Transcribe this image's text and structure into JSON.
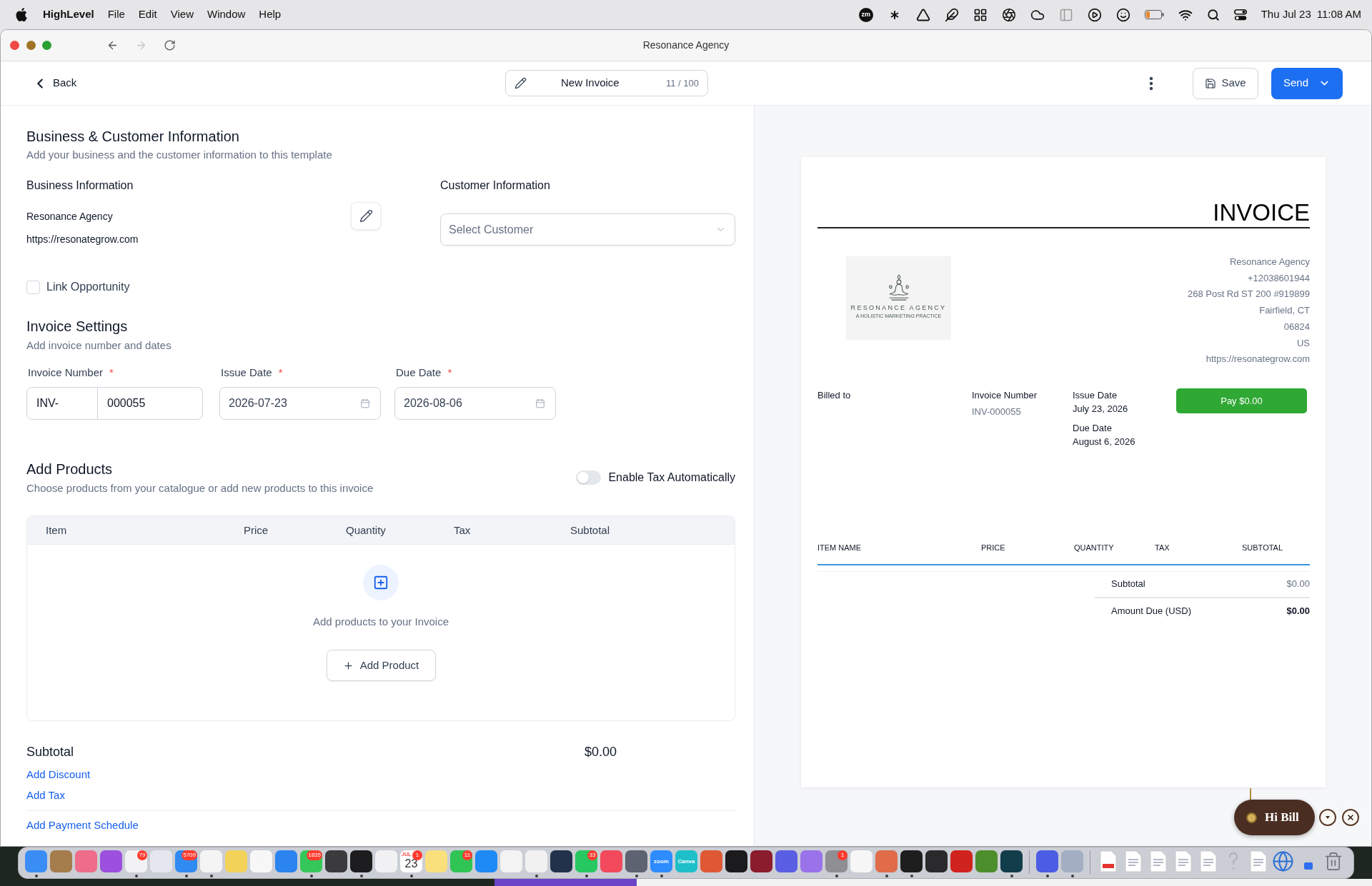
{
  "menu_bar": {
    "app_name": "HighLevel",
    "menus": [
      "File",
      "Edit",
      "View",
      "Window",
      "Help"
    ],
    "status_item": "zm",
    "date": "Thu Jul 23",
    "time": "11:08 AM"
  },
  "browser": {
    "title": "Resonance Agency",
    "back_disabled": false,
    "forward_disabled": true
  },
  "header": {
    "back": "Back",
    "title": "New Invoice",
    "counter": "11 / 100",
    "save": "Save",
    "send": "Send"
  },
  "business_customer": {
    "title": "Business & Customer Information",
    "subtitle": "Add your business and the customer information to this template",
    "business": {
      "heading": "Business Information",
      "name": "Resonance Agency",
      "website": "https://resonategrow.com"
    },
    "customer": {
      "heading": "Customer Information",
      "placeholder": "Select Customer"
    },
    "link_opportunity": {
      "label": "Link Opportunity",
      "checked": false
    }
  },
  "invoice_settings": {
    "title": "Invoice Settings",
    "subtitle": "Add invoice number and dates",
    "fields": [
      {
        "kind": "number",
        "label": "Invoice Number",
        "required_mark": "*",
        "prefix": "INV-",
        "value": "000055"
      },
      {
        "kind": "date",
        "label": "Issue Date",
        "required_mark": "*",
        "value": "2026-07-23"
      },
      {
        "kind": "date",
        "label": "Due Date",
        "required_mark": "*",
        "value": "2026-08-06"
      }
    ]
  },
  "products": {
    "title": "Add Products",
    "subtitle": "Choose products from your catalogue or add new products to this invoice",
    "tax_toggle": {
      "label": "Enable Tax Automatically",
      "on": false
    },
    "columns": [
      "Item",
      "Price",
      "Quantity",
      "Tax",
      "Subtotal"
    ],
    "empty_text": "Add products to your Invoice",
    "add_button": "Add Product"
  },
  "totals": {
    "subtotal_label": "Subtotal",
    "subtotal_value": "$0.00",
    "adjustments": [
      "Add Discount",
      "Add Tax"
    ],
    "schedule_link": "Add Payment Schedule"
  },
  "preview": {
    "title": "INVOICE",
    "logo": {
      "name": "RESONANCE AGENCY",
      "tagline": "A HOLISTIC MARKETING PRACTICE"
    },
    "address": [
      "Resonance Agency",
      "+12038601944",
      "268 Post Rd ST 200 #919899",
      "Fairfield, CT",
      "06824",
      "US",
      "https://resonategrow.com"
    ],
    "billed_to": "Billed to",
    "invoice_number": {
      "label": "Invoice Number",
      "value": "INV-000055"
    },
    "issue_date": {
      "label": "Issue Date",
      "value": "July 23, 2026"
    },
    "due_date": {
      "label": "Due Date",
      "value": "August 6, 2026"
    },
    "pay_button": "Pay $0.00",
    "columns": [
      "ITEM NAME",
      "PRICE",
      "QUANTITY",
      "TAX",
      "SUBTOTAL"
    ],
    "subtotal": {
      "label": "Subtotal",
      "value": "$0.00"
    },
    "amount_due": {
      "label": "Amount Due (USD)",
      "value": "$0.00"
    }
  },
  "chat_widget": {
    "greeting": "Hi Bill"
  },
  "dock": {
    "apps": [
      {
        "kind": "app",
        "color": "#3a8df4",
        "running": true
      },
      {
        "kind": "app",
        "color": "#a57c4c",
        "running": false
      },
      {
        "kind": "app",
        "color": "#ef6d8a",
        "running": false
      },
      {
        "kind": "app",
        "color": "#9c50dd",
        "running": false
      },
      {
        "kind": "app",
        "color": "#f2f2f4",
        "running": true,
        "badge": "79"
      },
      {
        "kind": "app",
        "color": "#e5e7ee",
        "running": false
      },
      {
        "kind": "app",
        "color": "#2f8bf2",
        "running": true,
        "badge": "5709"
      },
      {
        "kind": "app",
        "color": "#f4f4f4",
        "running": true
      },
      {
        "kind": "app",
        "color": "#f4d35a",
        "running": false
      },
      {
        "kind": "app",
        "color": "#f7f7f7",
        "running": false
      },
      {
        "kind": "app",
        "color": "#2b84f0",
        "running": false
      },
      {
        "kind": "app",
        "color": "#35c75a",
        "running": true,
        "badge": "1835"
      },
      {
        "kind": "app",
        "color": "#3b3b3d",
        "running": false
      },
      {
        "kind": "app",
        "color": "#1d1d1f",
        "running": true
      },
      {
        "kind": "app",
        "color": "#f1f1f3",
        "running": false
      },
      {
        "kind": "calendar",
        "color": "#ffffff",
        "running": true,
        "month": "JUL",
        "label": "23",
        "badge": "1"
      },
      {
        "kind": "app",
        "color": "#f9e07c",
        "running": false
      },
      {
        "kind": "app",
        "color": "#30c455",
        "running": false,
        "badge": "11"
      },
      {
        "kind": "app",
        "color": "#1e8af5",
        "running": false
      },
      {
        "kind": "app",
        "color": "#f3f3f3",
        "running": false
      },
      {
        "kind": "app",
        "color": "#f1f1f1",
        "running": true
      },
      {
        "kind": "app",
        "color": "#22324a",
        "running": false
      },
      {
        "kind": "app",
        "color": "#27c861",
        "running": true,
        "badge": "33"
      },
      {
        "kind": "app",
        "color": "#f2495c",
        "running": false
      },
      {
        "kind": "app",
        "color": "#5d6371",
        "running": true
      },
      {
        "kind": "labeled",
        "color": "#2d8cff",
        "running": true,
        "label": "zoom"
      },
      {
        "kind": "labeled",
        "color": "#1fbfc9",
        "running": false,
        "label": "Canva"
      },
      {
        "kind": "app",
        "color": "#de5833",
        "running": false
      },
      {
        "kind": "app",
        "color": "#1b1b1d",
        "running": false
      },
      {
        "kind": "app",
        "color": "#8a1c2e",
        "running": false
      },
      {
        "kind": "app",
        "color": "#5a5ee3",
        "running": false
      },
      {
        "kind": "app",
        "color": "#9a72ea",
        "running": false
      },
      {
        "kind": "app",
        "color": "#8e8e93",
        "running": true,
        "badge": "1"
      },
      {
        "kind": "app",
        "color": "#f6f6f6",
        "running": false
      },
      {
        "kind": "app",
        "color": "#e06c4a",
        "running": true
      },
      {
        "kind": "app",
        "color": "#1e1e1e",
        "running": true
      },
      {
        "kind": "app",
        "color": "#2a2a2c",
        "running": false
      },
      {
        "kind": "app",
        "color": "#d1231d",
        "running": false
      },
      {
        "kind": "app",
        "color": "#4d8e2c",
        "running": false
      },
      {
        "kind": "app",
        "color": "#123d4a",
        "running": true
      }
    ],
    "utilities": [
      {
        "kind": "app",
        "color": "#4b5de3",
        "running": true
      },
      {
        "kind": "app",
        "color": "#a3aec3",
        "running": true
      }
    ],
    "files": [
      {
        "kind": "pdf"
      },
      {
        "kind": "document"
      },
      {
        "kind": "document"
      },
      {
        "kind": "document"
      },
      {
        "kind": "document"
      },
      {
        "kind": "unknown"
      },
      {
        "kind": "document"
      },
      {
        "kind": "globe"
      },
      {
        "kind": "window"
      }
    ]
  }
}
